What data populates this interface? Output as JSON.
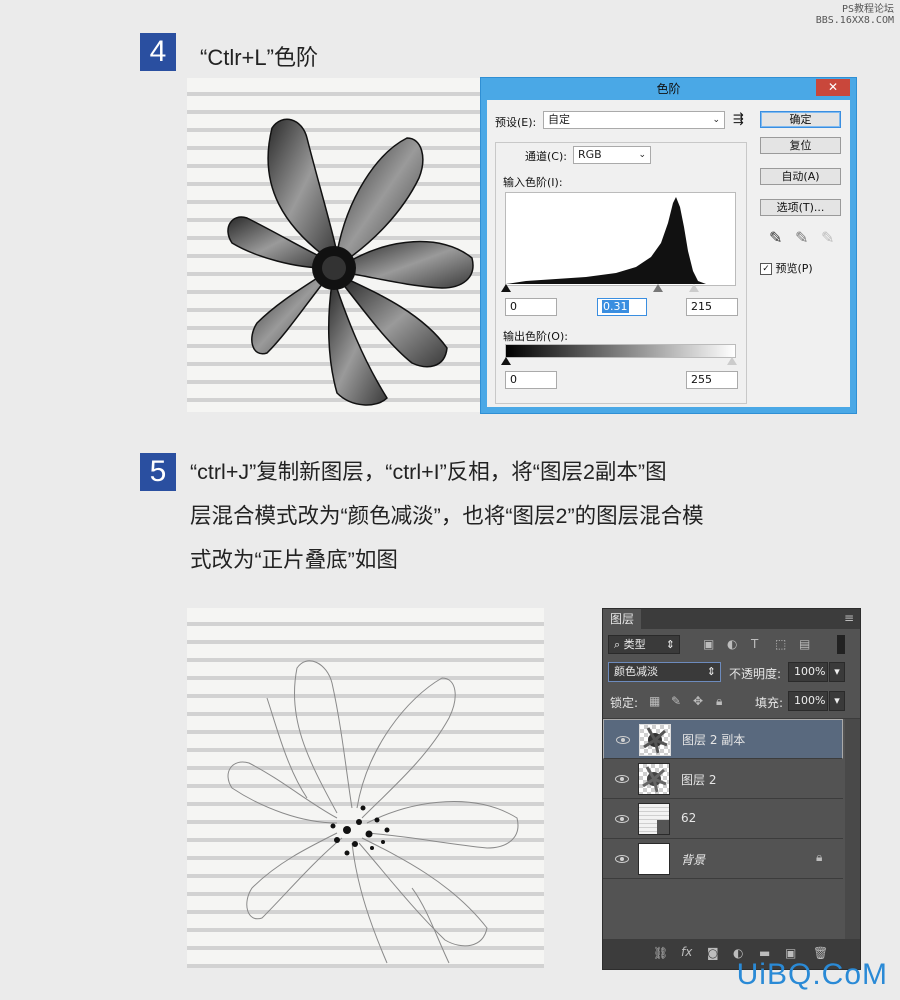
{
  "watermark_top": [
    "PS教程论坛",
    "BBS.16XX8.COM"
  ],
  "watermark_bottom": "UiBQ.CoM",
  "step4": {
    "number": "4",
    "title": "“Ctlr+L”色阶"
  },
  "levels_dialog": {
    "title": "色阶",
    "close": "✕",
    "preset_label": "预设(E):",
    "preset_value": "自定",
    "channel_label": "通道(C):",
    "channel_value": "RGB",
    "input_label": "输入色阶(I):",
    "input_values": [
      "0",
      "0.31",
      "215"
    ],
    "output_label": "输出色阶(O):",
    "output_values": [
      "0",
      "255"
    ],
    "buttons": {
      "ok": "确定",
      "reset": "复位",
      "auto": "自动(A)",
      "options": "选项(T)..."
    },
    "preview_label": "预览(P)",
    "preview_checked": true
  },
  "step5": {
    "number": "5",
    "lines": [
      "“ctrl+J”复制新图层，“ctrl+I”反相，将“图层2副本”图",
      "层混合模式改为“颜色减淡”，也将“图层2”的图层混合模",
      "式改为“正片叠底”如图"
    ]
  },
  "layers_panel": {
    "tab": "图层",
    "filter_kind": "类型",
    "blend_mode": "颜色减淡",
    "opacity_label": "不透明度:",
    "opacity_value": "100%",
    "lock_label": "锁定:",
    "fill_label": "填充:",
    "fill_value": "100%",
    "layers": [
      {
        "name": "图层 2 副本",
        "selected": true
      },
      {
        "name": "图层 2",
        "selected": false
      },
      {
        "name": "62",
        "selected": false
      },
      {
        "name": "背景",
        "selected": false,
        "locked": true
      }
    ]
  }
}
